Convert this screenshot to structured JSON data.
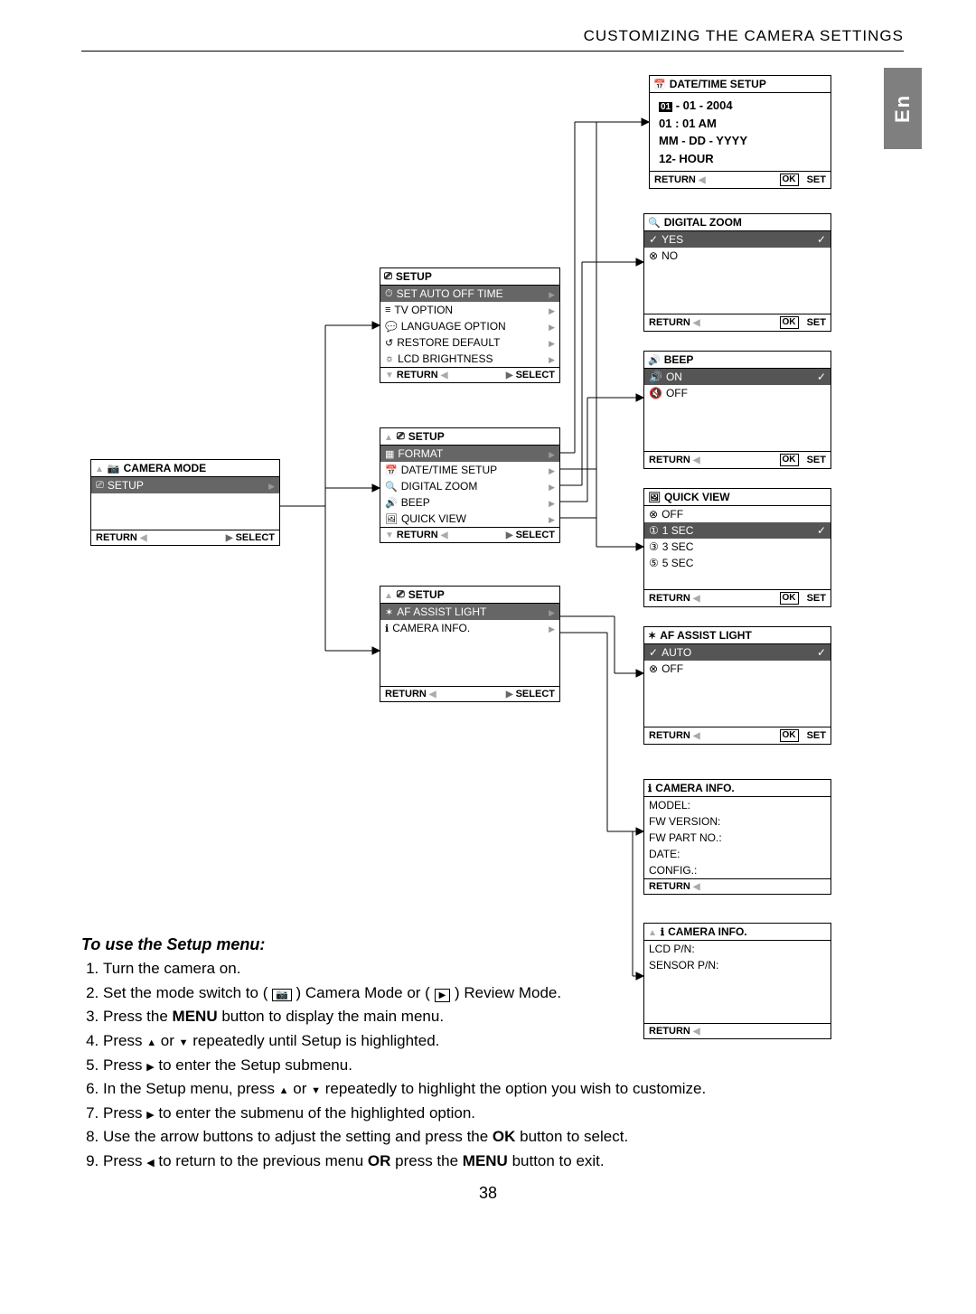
{
  "header": "CUSTOMIZING THE CAMERA SETTINGS",
  "lang_tab": "En",
  "page_number": "38",
  "panels": {
    "camera_mode": {
      "title": "CAMERA MODE",
      "row_setup": "SETUP",
      "footer_return": "RETURN",
      "footer_select": "SELECT"
    },
    "setup1": {
      "title": "SETUP",
      "rows": [
        "SET AUTO OFF TIME",
        "TV OPTION",
        "LANGUAGE OPTION",
        "RESTORE DEFAULT",
        "LCD BRIGHTNESS"
      ],
      "footer_return": "RETURN",
      "footer_select": "SELECT"
    },
    "setup2": {
      "title": "SETUP",
      "rows": [
        "FORMAT",
        "DATE/TIME SETUP",
        "DIGITAL ZOOM",
        "BEEP",
        "QUICK VIEW"
      ],
      "footer_return": "RETURN",
      "footer_select": "SELECT"
    },
    "setup3": {
      "title": "SETUP",
      "rows": [
        "AF ASSIST LIGHT",
        "CAMERA INFO."
      ],
      "footer_return": "RETURN",
      "footer_select": "SELECT"
    },
    "datetime": {
      "title": "DATE/TIME SETUP",
      "line1_a": "01",
      "line1_b": " - 01 - 2004",
      "line2": "01 : 01 AM",
      "line3": "MM - DD - YYYY",
      "line4": "12- HOUR",
      "footer_return": "RETURN",
      "footer_ok": "OK",
      "footer_set": "SET"
    },
    "digizoom": {
      "title": "DIGITAL  ZOOM",
      "rows": [
        {
          "icon": "✓",
          "label": "YES",
          "selected": true
        },
        {
          "icon": "⊗",
          "label": "NO",
          "selected": false
        }
      ],
      "footer_return": "RETURN",
      "footer_ok": "OK",
      "footer_set": "SET"
    },
    "beep": {
      "title": "BEEP",
      "rows": [
        {
          "icon": "🔊",
          "label": "ON",
          "selected": true
        },
        {
          "icon": "🔇",
          "label": "OFF",
          "selected": false
        }
      ],
      "footer_return": "RETURN",
      "footer_ok": "OK",
      "footer_set": "SET"
    },
    "quickview": {
      "title": "QUICK VIEW",
      "rows": [
        {
          "icon": "⊗",
          "label": "OFF",
          "selected": false
        },
        {
          "icon": "①",
          "label": "1 SEC",
          "selected": true
        },
        {
          "icon": "③",
          "label": "3 SEC",
          "selected": false
        },
        {
          "icon": "⑤",
          "label": "5 SEC",
          "selected": false
        }
      ],
      "footer_return": "RETURN",
      "footer_ok": "OK",
      "footer_set": "SET"
    },
    "afassist": {
      "title": "AF ASSIST LIGHT",
      "rows": [
        {
          "icon": "✓",
          "label": "AUTO",
          "selected": true
        },
        {
          "icon": "⊗",
          "label": "OFF",
          "selected": false
        }
      ],
      "footer_return": "RETURN",
      "footer_ok": "OK",
      "footer_set": "SET"
    },
    "caminfo1": {
      "title": "CAMERA  INFO.",
      "rows": [
        "MODEL:",
        "FW VERSION:",
        "FW PART NO.:",
        "DATE:",
        "CONFIG.:"
      ],
      "footer_return": "RETURN"
    },
    "caminfo2": {
      "title": "CAMERA  INFO.",
      "rows": [
        "LCD P/N:",
        "SENSOR P/N:"
      ],
      "footer_return": "RETURN"
    }
  },
  "instructions": {
    "title": "To use  the Setup menu:",
    "items": {
      "i1": "Turn the camera on.",
      "i2a": "Set the mode switch to ( ",
      "i2b": " ) Camera Mode or ( ",
      "i2c": " ) Review Mode.",
      "i3a": "Press the ",
      "i3b": "MENU",
      "i3c": " button to display the main menu.",
      "i4a": "Press ",
      "i4b": "  or  ",
      "i4c": "  repeatedly until Setup is highlighted.",
      "i5a": "Press ",
      "i5b": "  to enter the Setup submenu.",
      "i6a": "In the Setup menu, press  ",
      "i6b": "  or  ",
      "i6c": "  repeatedly to highlight the option you wish to customize.",
      "i7a": "Press ",
      "i7b": "  to enter the submenu of the highlighted option.",
      "i8a": "Use the arrow buttons to adjust the setting and press the ",
      "i8b": "OK",
      "i8c": " button to select.",
      "i9a": "Press ",
      "i9b": "  to return to the previous menu ",
      "i9c": "OR",
      "i9d": " press the ",
      "i9e": "MENU",
      "i9f": " button to exit."
    }
  }
}
